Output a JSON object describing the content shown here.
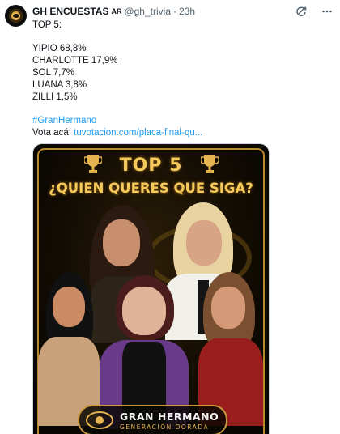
{
  "tweet": {
    "display_name": "GH ENCUESTAS",
    "name_tag": "AR",
    "handle": "@gh_trivia",
    "separator": "·",
    "time": "23h",
    "lines": {
      "intro": "TOP 5:",
      "r1": "YIPIO 68,8%",
      "r2": "CHARLOTTE 17,9%",
      "r3": "SOL 7,7%",
      "r4": "LUANA 3,8%",
      "r5": "ZILLI 1,5%",
      "hashtag": "#GranHermano",
      "vote_prefix": "Vota acá: ",
      "vote_link": "tuvotacion.com/placa-final-qu..."
    },
    "icons": {
      "grok": "grok-refresh-icon",
      "more": "more-options-icon",
      "avatar": "gh-eye-logo"
    }
  },
  "media": {
    "title": "TOP 5",
    "subtitle": "¿QUIEN QUERES QUE SIGA?",
    "badge_title": "GRAN HERMANO",
    "badge_sub": "GENERACIÓN DORADA"
  },
  "colors": {
    "link": "#1d9bf0",
    "gold": "#f5c95a",
    "muted": "#536471"
  }
}
